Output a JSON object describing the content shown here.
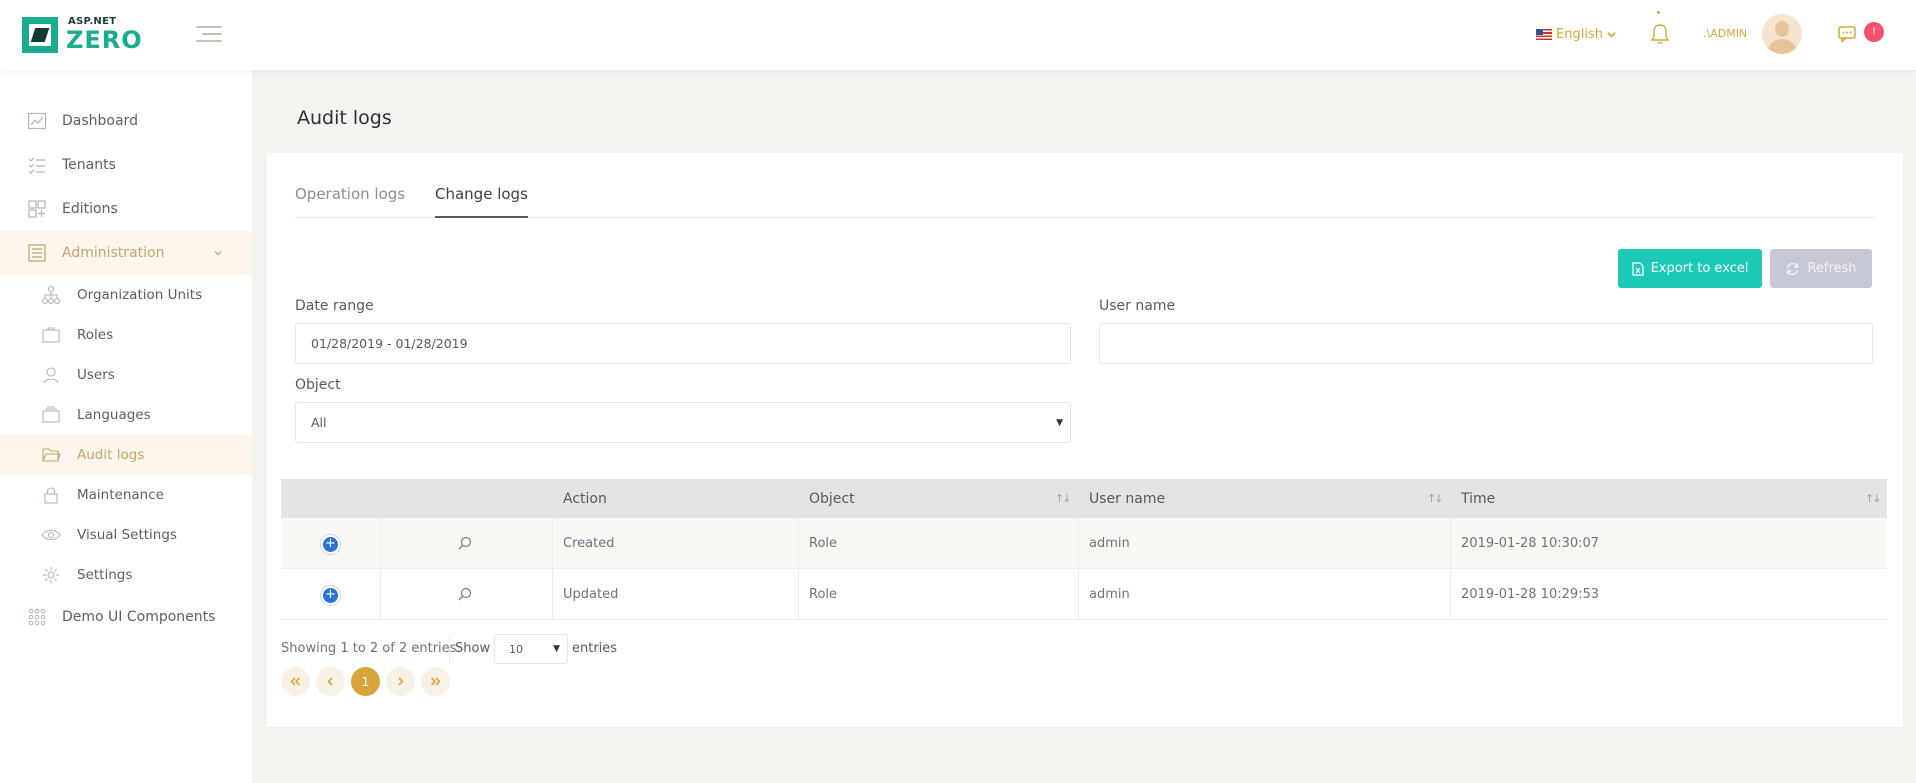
{
  "brand": {
    "line1": "ASP.NET",
    "line2": "ZERO"
  },
  "header": {
    "language": "English",
    "user_name": ".\\ADMIN",
    "chat_badge": "!"
  },
  "sidebar": {
    "items": [
      {
        "label": "Dashboard"
      },
      {
        "label": "Tenants"
      },
      {
        "label": "Editions"
      },
      {
        "label": "Administration"
      },
      {
        "label": "Organization Units"
      },
      {
        "label": "Roles"
      },
      {
        "label": "Users"
      },
      {
        "label": "Languages"
      },
      {
        "label": "Audit logs"
      },
      {
        "label": "Maintenance"
      },
      {
        "label": "Visual Settings"
      },
      {
        "label": "Settings"
      },
      {
        "label": "Demo UI Components"
      }
    ]
  },
  "page": {
    "title": "Audit logs"
  },
  "tabs": [
    {
      "label": "Operation logs"
    },
    {
      "label": "Change logs"
    }
  ],
  "toolbar": {
    "export_label": "Export to excel",
    "refresh_label": "Refresh"
  },
  "filters": {
    "date_range_label": "Date range",
    "date_range_value": "01/28/2019 - 01/28/2019",
    "user_name_label": "User name",
    "user_name_value": "",
    "object_label": "Object",
    "object_value": "All"
  },
  "table": {
    "columns": [
      "",
      "",
      "Action",
      "Object",
      "User name",
      "Time"
    ],
    "rows": [
      {
        "action": "Created",
        "object": "Role",
        "user": "admin",
        "time": "2019-01-28 10:30:07"
      },
      {
        "action": "Updated",
        "object": "Role",
        "user": "admin",
        "time": "2019-01-28 10:29:53"
      }
    ]
  },
  "footer": {
    "info": "Showing 1 to 2 of 2 entries",
    "show_label": "Show",
    "page_size": "10",
    "entries_label": "entries",
    "current_page": "1"
  },
  "colors": {
    "accent": "#d7a63a",
    "brand_green": "#1aac8e",
    "excel_button": "#1dc9b7",
    "refresh_button": "#c7c8d6",
    "badge": "#f4516c"
  }
}
